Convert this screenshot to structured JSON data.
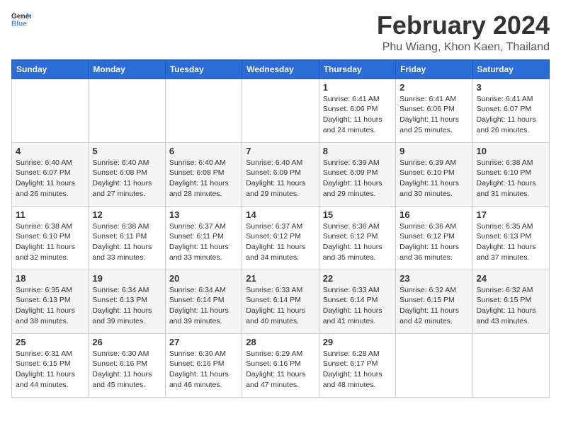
{
  "header": {
    "logo_general": "General",
    "logo_blue": "Blue",
    "main_title": "February 2024",
    "subtitle": "Phu Wiang, Khon Kaen, Thailand"
  },
  "weekdays": [
    "Sunday",
    "Monday",
    "Tuesday",
    "Wednesday",
    "Thursday",
    "Friday",
    "Saturday"
  ],
  "weeks": [
    [
      {
        "day": "",
        "info": ""
      },
      {
        "day": "",
        "info": ""
      },
      {
        "day": "",
        "info": ""
      },
      {
        "day": "",
        "info": ""
      },
      {
        "day": "1",
        "info": "Sunrise: 6:41 AM\nSunset: 6:06 PM\nDaylight: 11 hours and 24 minutes."
      },
      {
        "day": "2",
        "info": "Sunrise: 6:41 AM\nSunset: 6:06 PM\nDaylight: 11 hours and 25 minutes."
      },
      {
        "day": "3",
        "info": "Sunrise: 6:41 AM\nSunset: 6:07 PM\nDaylight: 11 hours and 26 minutes."
      }
    ],
    [
      {
        "day": "4",
        "info": "Sunrise: 6:40 AM\nSunset: 6:07 PM\nDaylight: 11 hours and 26 minutes."
      },
      {
        "day": "5",
        "info": "Sunrise: 6:40 AM\nSunset: 6:08 PM\nDaylight: 11 hours and 27 minutes."
      },
      {
        "day": "6",
        "info": "Sunrise: 6:40 AM\nSunset: 6:08 PM\nDaylight: 11 hours and 28 minutes."
      },
      {
        "day": "7",
        "info": "Sunrise: 6:40 AM\nSunset: 6:09 PM\nDaylight: 11 hours and 29 minutes."
      },
      {
        "day": "8",
        "info": "Sunrise: 6:39 AM\nSunset: 6:09 PM\nDaylight: 11 hours and 29 minutes."
      },
      {
        "day": "9",
        "info": "Sunrise: 6:39 AM\nSunset: 6:10 PM\nDaylight: 11 hours and 30 minutes."
      },
      {
        "day": "10",
        "info": "Sunrise: 6:38 AM\nSunset: 6:10 PM\nDaylight: 11 hours and 31 minutes."
      }
    ],
    [
      {
        "day": "11",
        "info": "Sunrise: 6:38 AM\nSunset: 6:10 PM\nDaylight: 11 hours and 32 minutes."
      },
      {
        "day": "12",
        "info": "Sunrise: 6:38 AM\nSunset: 6:11 PM\nDaylight: 11 hours and 33 minutes."
      },
      {
        "day": "13",
        "info": "Sunrise: 6:37 AM\nSunset: 6:11 PM\nDaylight: 11 hours and 33 minutes."
      },
      {
        "day": "14",
        "info": "Sunrise: 6:37 AM\nSunset: 6:12 PM\nDaylight: 11 hours and 34 minutes."
      },
      {
        "day": "15",
        "info": "Sunrise: 6:36 AM\nSunset: 6:12 PM\nDaylight: 11 hours and 35 minutes."
      },
      {
        "day": "16",
        "info": "Sunrise: 6:36 AM\nSunset: 6:12 PM\nDaylight: 11 hours and 36 minutes."
      },
      {
        "day": "17",
        "info": "Sunrise: 6:35 AM\nSunset: 6:13 PM\nDaylight: 11 hours and 37 minutes."
      }
    ],
    [
      {
        "day": "18",
        "info": "Sunrise: 6:35 AM\nSunset: 6:13 PM\nDaylight: 11 hours and 38 minutes."
      },
      {
        "day": "19",
        "info": "Sunrise: 6:34 AM\nSunset: 6:13 PM\nDaylight: 11 hours and 39 minutes."
      },
      {
        "day": "20",
        "info": "Sunrise: 6:34 AM\nSunset: 6:14 PM\nDaylight: 11 hours and 39 minutes."
      },
      {
        "day": "21",
        "info": "Sunrise: 6:33 AM\nSunset: 6:14 PM\nDaylight: 11 hours and 40 minutes."
      },
      {
        "day": "22",
        "info": "Sunrise: 6:33 AM\nSunset: 6:14 PM\nDaylight: 11 hours and 41 minutes."
      },
      {
        "day": "23",
        "info": "Sunrise: 6:32 AM\nSunset: 6:15 PM\nDaylight: 11 hours and 42 minutes."
      },
      {
        "day": "24",
        "info": "Sunrise: 6:32 AM\nSunset: 6:15 PM\nDaylight: 11 hours and 43 minutes."
      }
    ],
    [
      {
        "day": "25",
        "info": "Sunrise: 6:31 AM\nSunset: 6:15 PM\nDaylight: 11 hours and 44 minutes."
      },
      {
        "day": "26",
        "info": "Sunrise: 6:30 AM\nSunset: 6:16 PM\nDaylight: 11 hours and 45 minutes."
      },
      {
        "day": "27",
        "info": "Sunrise: 6:30 AM\nSunset: 6:16 PM\nDaylight: 11 hours and 46 minutes."
      },
      {
        "day": "28",
        "info": "Sunrise: 6:29 AM\nSunset: 6:16 PM\nDaylight: 11 hours and 47 minutes."
      },
      {
        "day": "29",
        "info": "Sunrise: 6:28 AM\nSunset: 6:17 PM\nDaylight: 11 hours and 48 minutes."
      },
      {
        "day": "",
        "info": ""
      },
      {
        "day": "",
        "info": ""
      }
    ]
  ]
}
